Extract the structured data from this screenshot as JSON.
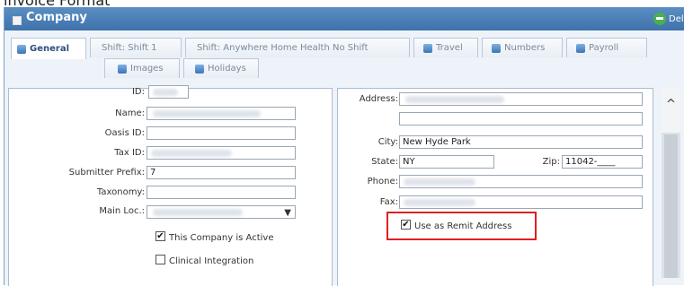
{
  "top_text": "invoice Format",
  "window": {
    "title": "Company",
    "delete_label": "Delete"
  },
  "tabs": [
    {
      "label": "General",
      "has_icon": true,
      "active": true
    },
    {
      "label": "Shift: Shift 1",
      "has_icon": false,
      "active": false
    },
    {
      "label": "Shift: Anywhere Home Health No Shift",
      "has_icon": false,
      "active": false
    },
    {
      "label": "Travel",
      "has_icon": true,
      "active": false
    },
    {
      "label": "Numbers",
      "has_icon": true,
      "active": false
    },
    {
      "label": "Payroll",
      "has_icon": true,
      "active": false
    },
    {
      "label": "Images",
      "has_icon": true,
      "active": false
    },
    {
      "label": "Holidays",
      "has_icon": true,
      "active": false
    }
  ],
  "left_form": {
    "id_label": "ID:",
    "name_label": "Name:",
    "oasis_label": "Oasis ID:",
    "tax_label": "Tax ID:",
    "submitter_label": "Submitter Prefix:",
    "submitter_value": "7",
    "taxonomy_label": "Taxonomy:",
    "mainloc_label": "Main Loc.:",
    "active_label": "This Company is Active",
    "active_checked": "✔",
    "clinical_label": "Clinical Integration"
  },
  "right_form": {
    "address_label": "Address:",
    "city_label": "City:",
    "city_value": "New Hyde Park",
    "state_label": "State:",
    "state_value": "NY",
    "zip_label": "Zip:",
    "zip_value": "11042-____",
    "phone_label": "Phone:",
    "fax_label": "Fax:",
    "remit_label": "Use as Remit Address",
    "remit_checked": "✔"
  },
  "colors": {
    "titlebar": "#4a7fb7",
    "highlight": "#e02020",
    "delete_icon": "#4caf50"
  },
  "icons": [
    "company-icon",
    "delete-icon",
    "tab-icon",
    "chevron-down-icon",
    "scroll-up-icon"
  ]
}
